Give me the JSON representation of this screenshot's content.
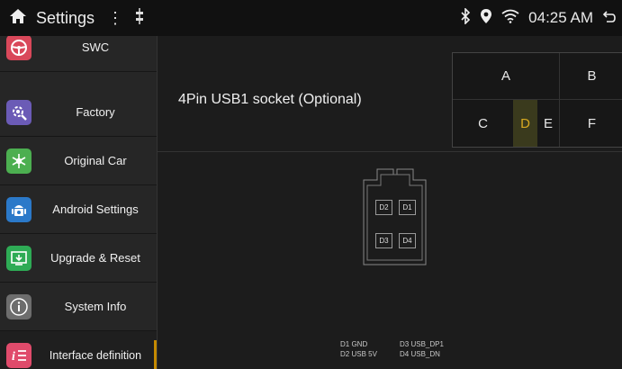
{
  "statusbar": {
    "title": "Settings",
    "menu_glyph": "⋮",
    "time": "04:25 AM"
  },
  "sidebar": {
    "items": [
      {
        "label": "SWC",
        "icon": "steering-wheel-icon",
        "color": "#d9485a"
      },
      {
        "label": "Factory",
        "icon": "factory-gear-icon",
        "color": "#6b5bb6"
      },
      {
        "label": "Original Car",
        "icon": "snowflake-icon",
        "color": "#4caf50"
      },
      {
        "label": "Android Settings",
        "icon": "android-icon",
        "color": "#2b79c9"
      },
      {
        "label": "Upgrade & Reset",
        "icon": "upgrade-icon",
        "color": "#2eab55"
      },
      {
        "label": "System Info",
        "icon": "info-icon",
        "color": "#6d6d6d"
      },
      {
        "label": "Interface definition",
        "icon": "interface-definition-icon",
        "color": "#e04b6b"
      }
    ]
  },
  "main": {
    "title": "4Pin USB1 socket (Optional)",
    "tabs": [
      "A",
      "B",
      "C",
      "D",
      "E",
      "F"
    ],
    "selected_tab": "D",
    "pins": [
      "D2",
      "D1",
      "D3",
      "D4"
    ],
    "legend": {
      "d1": "D1 GND",
      "d2": "D2 USB 5V",
      "d3": "D3 USB_DP1",
      "d4": "D4 USB_DN"
    }
  },
  "colors": {
    "accent": "#d7a920",
    "background": "#1c1c1c",
    "sidebar": "#262626"
  }
}
